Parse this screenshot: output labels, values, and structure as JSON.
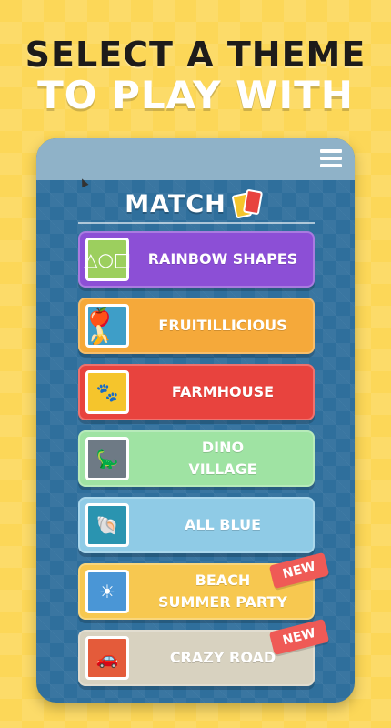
{
  "headline": {
    "line1": "SELECT A THEME",
    "line2": "TO PLAY WITH"
  },
  "app": {
    "title": "MATCH",
    "menu_icon": "hamburger-menu-icon",
    "colors": {
      "background": "#fcd758",
      "frame": "#2f6f9c",
      "topbar": "#8fb2c8"
    }
  },
  "themes": [
    {
      "label": "RAINBOW SHAPES",
      "color": "#8c4fd6",
      "thumb_color": "#9ccf5e",
      "icon": "shapes-icon",
      "glyph": "△○□",
      "badge": ""
    },
    {
      "label": "FRUITILLICIOUS",
      "color": "#f5a93a",
      "thumb_color": "#3e9ec8",
      "icon": "fruit-icon",
      "glyph": "🍎🍌",
      "badge": ""
    },
    {
      "label": "FARMHOUSE",
      "color": "#e8433e",
      "thumb_color": "#f5c52c",
      "icon": "paw-prints-icon",
      "glyph": "🐾",
      "badge": ""
    },
    {
      "label": "DINO\nVILLAGE",
      "color": "#9fe3a3",
      "thumb_color": "#6e7a85",
      "icon": "dinosaur-icon",
      "glyph": "🦕",
      "badge": ""
    },
    {
      "label": "ALL BLUE",
      "color": "#8fcbe6",
      "thumb_color": "#2a94b0",
      "icon": "sea-shells-icon",
      "glyph": "🐚",
      "badge": ""
    },
    {
      "label": "BEACH\nSUMMER PARTY",
      "color": "#f7c850",
      "thumb_color": "#4a96d6",
      "icon": "beach-sun-icon",
      "glyph": "☀",
      "badge": "NEW"
    },
    {
      "label": "CRAZY ROAD",
      "color": "#d8d2c0",
      "thumb_color": "#e45b3a",
      "icon": "vehicles-icon",
      "glyph": "🚗",
      "badge": "NEW"
    }
  ]
}
